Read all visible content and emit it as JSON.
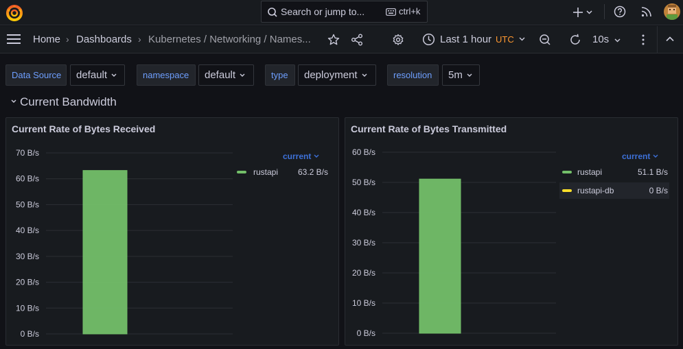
{
  "topbar": {
    "search_placeholder": "Search or jump to...",
    "search_shortcut": "ctrl+k"
  },
  "breadcrumb": {
    "home": "Home",
    "dashboards": "Dashboards",
    "current": "Kubernetes / Networking / Names..."
  },
  "toolbar": {
    "time_range": "Last 1 hour",
    "timezone": "UTC",
    "refresh_interval": "10s"
  },
  "variables": [
    {
      "label": "Data Source",
      "value": "default"
    },
    {
      "label": "namespace",
      "value": "default"
    },
    {
      "label": "type",
      "value": "deployment"
    },
    {
      "label": "resolution",
      "value": "5m"
    }
  ],
  "row": {
    "title": "Current Bandwidth"
  },
  "colors": {
    "green": "#73bf69",
    "yellow": "#fade2a",
    "legend_header": "#3d71d9"
  },
  "panels": [
    {
      "title": "Current Rate of Bytes Received",
      "legend_header": "current",
      "legend": [
        {
          "name": "rustapi",
          "value": "63.2 B/s",
          "color": "#73bf69"
        }
      ],
      "chart_data": {
        "type": "bar",
        "categories": [
          "rustapi"
        ],
        "values": [
          63.2
        ],
        "ylim": [
          0,
          70
        ],
        "yticks": [
          "0 B/s",
          "10 B/s",
          "20 B/s",
          "30 B/s",
          "40 B/s",
          "50 B/s",
          "60 B/s",
          "70 B/s"
        ],
        "ytick_values": [
          0,
          10,
          20,
          30,
          40,
          50,
          60,
          70
        ]
      }
    },
    {
      "title": "Current Rate of Bytes Transmitted",
      "legend_header": "current",
      "legend": [
        {
          "name": "rustapi",
          "value": "51.1 B/s",
          "color": "#73bf69"
        },
        {
          "name": "rustapi-db",
          "value": "0 B/s",
          "color": "#fade2a"
        }
      ],
      "chart_data": {
        "type": "bar",
        "categories": [
          "rustapi",
          "rustapi-db"
        ],
        "values": [
          51.1,
          0
        ],
        "ylim": [
          0,
          60
        ],
        "yticks": [
          "0 B/s",
          "10 B/s",
          "20 B/s",
          "30 B/s",
          "40 B/s",
          "50 B/s",
          "60 B/s"
        ],
        "ytick_values": [
          0,
          10,
          20,
          30,
          40,
          50,
          60
        ]
      }
    }
  ]
}
